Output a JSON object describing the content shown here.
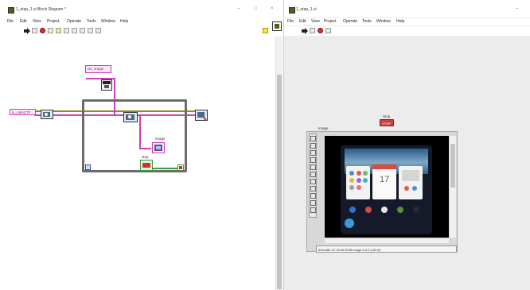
{
  "block_diagram": {
    "title": "1_stap_1.vi Block Diagram *",
    "menus": [
      "File",
      "Edit",
      "View",
      "Project",
      "Operate",
      "Tools",
      "Window",
      "Help"
    ],
    "controls": {
      "minimize": "–",
      "maximize": "□",
      "close": "×"
    },
    "nodes": {
      "session_label": "IL_camCTF",
      "image_const_label": "cis_image",
      "image_indicator_label": "Image",
      "stop_label": "stop",
      "loop_iteration": "i"
    }
  },
  "front_panel": {
    "title": "1_stap_1.vi",
    "menus": [
      "File",
      "Edit",
      "View",
      "Project",
      "Operate",
      "Tools",
      "Window",
      "Help"
    ],
    "controls": {
      "minimize": "–"
    },
    "stop_label": "Stop",
    "stop_button_text": "STOP",
    "image_label": "Image",
    "status_text": "640x480 1X 32-bit RGB image 0,0,0    (100,8)",
    "phone": {
      "date": "17"
    }
  },
  "colors": {
    "image_wire": "#cc3fb6",
    "session_wire": "#8f8a14",
    "loop_frame": "#6b6b6b",
    "stop_button": "#d04040"
  }
}
